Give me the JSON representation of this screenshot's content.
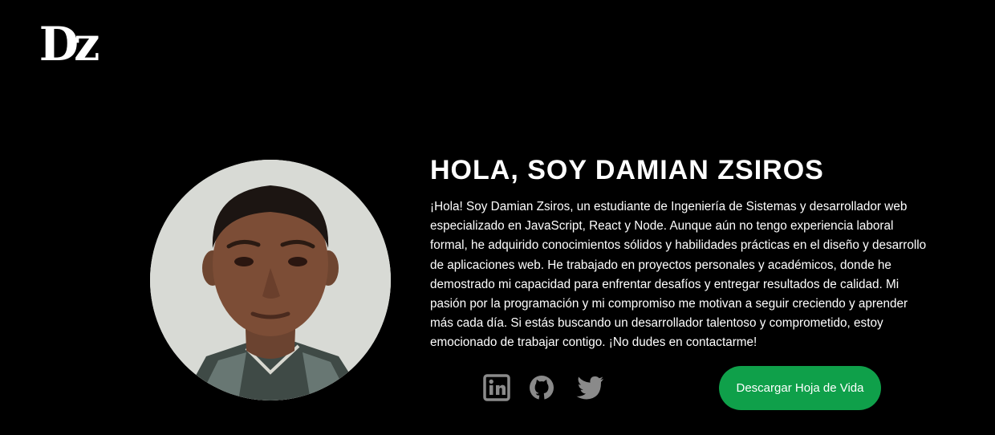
{
  "header": {
    "logo_text": "Dz"
  },
  "profile": {
    "photo_icon": "profile-photo",
    "title": "HOLA, SOY DAMIAN ZSIROS",
    "bio": "¡Hola! Soy Damian Zsiros, un estudiante de Ingeniería de Sistemas y desarrollador web especializado en JavaScript, React y Node. Aunque aún no tengo experiencia laboral formal, he adquirido conocimientos sólidos y habilidades prácticas en el diseño y desarrollo de aplicaciones web. He trabajado en proyectos personales y académicos, donde he demostrado mi capacidad para enfrentar desafíos y entregar resultados de calidad. Mi pasión por la programación y mi compromiso me motivan a seguir creciendo y aprender más cada día. Si estás buscando un desarrollador talentoso y comprometido, estoy emocionado de trabajar contigo. ¡No dudes en contactarme!"
  },
  "social": {
    "icons": [
      "linkedin-icon",
      "github-icon",
      "twitter-icon"
    ],
    "icon_color": "#8a8a8a"
  },
  "cv_button": {
    "label": "Descargar Hoja de Vida",
    "color": "#0fa04a"
  },
  "colors": {
    "background": "#000000",
    "text": "#ffffff"
  }
}
